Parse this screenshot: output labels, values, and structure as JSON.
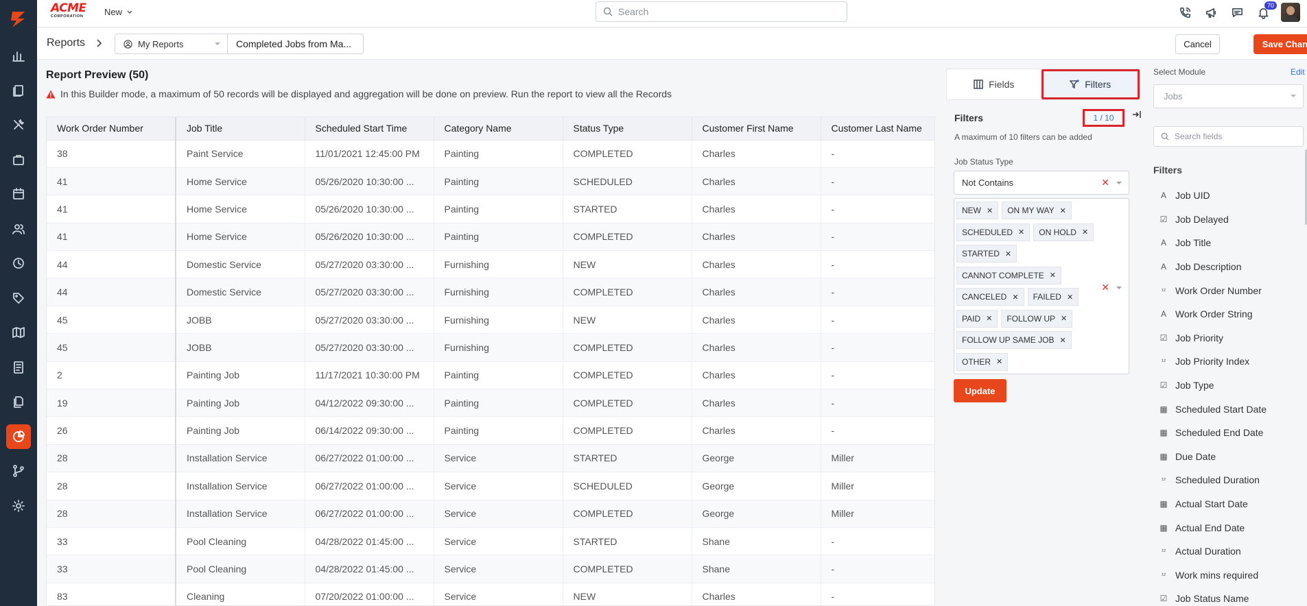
{
  "brand": {
    "name": "ACME",
    "sub": "CORPORATION"
  },
  "topbar": {
    "new_label": "New",
    "search_placeholder": "Search",
    "notifications_count": "70"
  },
  "breadcrumb": {
    "root": "Reports",
    "folder": "My Reports",
    "report_name": "Completed Jobs from Ma..."
  },
  "actions": {
    "cancel": "Cancel",
    "save": "Save Changes"
  },
  "preview": {
    "title": "Report Preview (50)",
    "warning": "In this Builder mode, a maximum of 50 records will be displayed and aggregation will be done on preview. Run the report to view all the Records",
    "columns": [
      "Work Order Number",
      "Job Title",
      "Scheduled Start Time",
      "Category Name",
      "Status Type",
      "Customer First Name",
      "Customer Last Name"
    ],
    "rows": [
      [
        "38",
        "Paint Service",
        "11/01/2021 12:45:00 PM",
        "Painting",
        "COMPLETED",
        "Charles",
        "-"
      ],
      [
        "41",
        "Home Service",
        "05/26/2020 10:30:00 ...",
        "Painting",
        "SCHEDULED",
        "Charles",
        "-"
      ],
      [
        "41",
        "Home Service",
        "05/26/2020 10:30:00 ...",
        "Painting",
        "STARTED",
        "Charles",
        "-"
      ],
      [
        "41",
        "Home Service",
        "05/26/2020 10:30:00 ...",
        "Painting",
        "COMPLETED",
        "Charles",
        "-"
      ],
      [
        "44",
        "Domestic Service",
        "05/27/2020 03:30:00 ...",
        "Furnishing",
        "NEW",
        "Charles",
        "-"
      ],
      [
        "44",
        "Domestic Service",
        "05/27/2020 03:30:00 ...",
        "Furnishing",
        "COMPLETED",
        "Charles",
        "-"
      ],
      [
        "45",
        "JOBB",
        "05/27/2020 03:30:00 ...",
        "Furnishing",
        "NEW",
        "Charles",
        "-"
      ],
      [
        "45",
        "JOBB",
        "05/27/2020 03:30:00 ...",
        "Furnishing",
        "COMPLETED",
        "Charles",
        "-"
      ],
      [
        "2",
        "Painting Job",
        "11/17/2021 10:30:00 PM",
        "Painting",
        "COMPLETED",
        "Charles",
        "-"
      ],
      [
        "19",
        "Painting Job",
        "04/12/2022 09:30:00 ...",
        "Painting",
        "COMPLETED",
        "Charles",
        "-"
      ],
      [
        "26",
        "Painting Job",
        "06/14/2022 09:30:00 ...",
        "Painting",
        "COMPLETED",
        "Charles",
        "-"
      ],
      [
        "28",
        "Installation Service",
        "06/27/2022 01:00:00 ...",
        "Service",
        "STARTED",
        "George",
        "Miller"
      ],
      [
        "28",
        "Installation Service",
        "06/27/2022 01:00:00 ...",
        "Service",
        "SCHEDULED",
        "George",
        "Miller"
      ],
      [
        "28",
        "Installation Service",
        "06/27/2022 01:00:00 ...",
        "Service",
        "COMPLETED",
        "George",
        "Miller"
      ],
      [
        "33",
        "Pool Cleaning",
        "04/28/2022 01:45:00 ...",
        "Service",
        "STARTED",
        "Shane",
        "-"
      ],
      [
        "33",
        "Pool Cleaning",
        "04/28/2022 01:45:00 ...",
        "Service",
        "COMPLETED",
        "Shane",
        "-"
      ],
      [
        "83",
        "Cleaning",
        "07/20/2022 01:00:00 ...",
        "Service",
        "NEW",
        "Charles",
        "-"
      ]
    ]
  },
  "filter_panel": {
    "tab_fields": "Fields",
    "tab_filters": "Filters",
    "label": "Filters",
    "count": "1 / 10",
    "hint": "A maximum of 10 filters can be added",
    "field_label": "Job Status Type",
    "operator": "Not Contains",
    "tag_rows": [
      [
        "NEW",
        "ON MY WAY"
      ],
      [
        "SCHEDULED",
        "ON HOLD"
      ],
      [
        "STARTED"
      ],
      [
        "CANNOT COMPLETE"
      ],
      [
        "CANCELED",
        "FAILED"
      ],
      [
        "PAID",
        "FOLLOW UP"
      ],
      [
        "FOLLOW UP SAME JOB"
      ],
      [
        "OTHER"
      ]
    ],
    "update_label": "Update"
  },
  "module_panel": {
    "title": "Select Module",
    "edit": "Edit",
    "module_placeholder": "Jobs",
    "search_placeholder": "Search fields",
    "filters_label": "Filters",
    "fields": [
      {
        "label": "Job UID",
        "icon": "text-icon"
      },
      {
        "label": "Job Delayed",
        "icon": "checkbox-icon"
      },
      {
        "label": "Job Title",
        "icon": "text-icon"
      },
      {
        "label": "Job Description",
        "icon": "text-icon"
      },
      {
        "label": "Work Order Number",
        "icon": "number-icon"
      },
      {
        "label": "Work Order String",
        "icon": "text-icon"
      },
      {
        "label": "Job Priority",
        "icon": "checkbox-icon"
      },
      {
        "label": "Job Priority Index",
        "icon": "number-icon"
      },
      {
        "label": "Job Type",
        "icon": "checkbox-icon"
      },
      {
        "label": "Scheduled Start Date",
        "icon": "calendar-icon"
      },
      {
        "label": "Scheduled End Date",
        "icon": "calendar-icon"
      },
      {
        "label": "Due Date",
        "icon": "calendar-icon"
      },
      {
        "label": "Scheduled Duration",
        "icon": "number-icon"
      },
      {
        "label": "Actual Start Date",
        "icon": "calendar-icon"
      },
      {
        "label": "Actual End Date",
        "icon": "calendar-icon"
      },
      {
        "label": "Actual Duration",
        "icon": "number-icon"
      },
      {
        "label": "Work mins required",
        "icon": "number-icon"
      },
      {
        "label": "Job Status Name",
        "icon": "checkbox-icon"
      }
    ]
  },
  "colors": {
    "accent": "#e8471c",
    "sidebar": "#1f2d3d",
    "highlight": "#d9262c",
    "link": "#3f6fd8"
  }
}
